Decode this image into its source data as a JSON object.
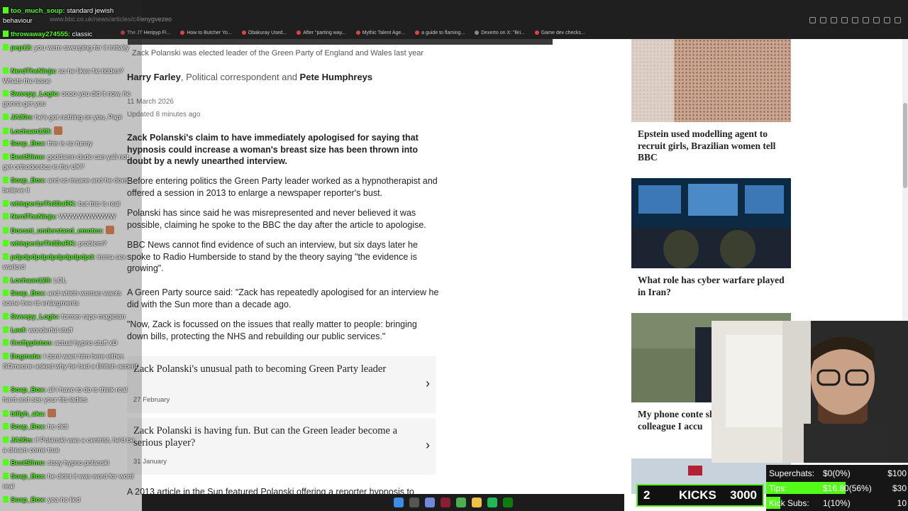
{
  "browser": {
    "url": "www.bbc.co.uk/news/articles/c4lenygvezeo",
    "bookmarks": [
      "The JT Heripyp Fi...",
      "How to Butcher Yo...",
      "Obakuray Used...",
      "After \"parting way...",
      "Mythic Talent Age...",
      "a guide to flaming...",
      "Dexerto on X: \"Bri...",
      "Game dev checks..."
    ]
  },
  "article": {
    "caption": "Zack Polanski was elected leader of the Green Party of England and Wales last year",
    "byline": {
      "author1": "Harry Farley",
      "role": ", Political correspondent and ",
      "author2": "Pete Humphreys"
    },
    "date": "11 March 2026",
    "updated": "Updated 8 minutes ago",
    "paragraphs": [
      "Zack Polanski's claim to have immediately apologised for saying that hypnosis could increase a woman's breast size has been thrown into doubt by a newly unearthed interview.",
      "Before entering politics the Green Party leader worked as a hypnotherapist and offered a session in 2013 to enlarge a newspaper reporter's bust.",
      "Polanski has since said he was misrepresented and never believed it was possible, claiming he spoke to the BBC the day after the article to apologise.",
      "BBC News cannot find evidence of such an interview, but six days later he spoke to Radio Humberside to stand by the theory saying \"the evidence is growing\".",
      "A Green Party source said: \"Zack has repeatedly apologised for an interview he did with the Sun more than a decade ago.",
      "\"Now, Zack is focussed on the issues that really matter to people: bringing down bills, protecting the NHS and rebuilding our public services.\""
    ],
    "related": [
      {
        "title": "Zack Polanski's unusual path to becoming Green Party leader",
        "date": "27 February"
      },
      {
        "title": "Zack Polanski is having fun. But can the Green leader become a serious player?",
        "date": "31 January"
      }
    ],
    "cutoff": "A 2013 article in the Sun featured Polanski offering a reporter hypnosis to"
  },
  "sidebar": [
    {
      "title": "Epstein used modelling agent to recruit girls, Brazilian women tell BBC"
    },
    {
      "title": "What role has cyber warfare played in Iran?"
    },
    {
      "title": "My phone conte shared with the colleague I accu"
    }
  ],
  "chat": [
    {
      "user": "too_much_soup:",
      "text": " standard jewish behaviour"
    },
    {
      "user": "throwaway274555:",
      "text": " classic"
    },
    {
      "user": "pep12:",
      "text": " you were sweeping for it initially"
    },
    {
      "user": "NerdTheNinja:",
      "text": " so he likes fat tiddes? Whats the issue"
    },
    {
      "user": "Sweepy_Logic:",
      "text": " oooo you did it now, he gonna get you"
    },
    {
      "user": "JA30n:",
      "text": " he's got nothing on you, Papi"
    },
    {
      "user": "Lochaan128:",
      "text": "",
      "emote": true
    },
    {
      "user": "Soap_Box:",
      "text": " this is so funny"
    },
    {
      "user": "BestSlime:",
      "text": " goddamn dude can yall not get orthodontics in the UK?"
    },
    {
      "user": "Soap_Box:",
      "text": " and so insane and he does believe it"
    },
    {
      "user": "whisper1nTh3DaRK:",
      "text": " but this is real"
    },
    {
      "user": "NerdTheNinja:",
      "text": " WWWWWWWWW"
    },
    {
      "user": "Doesnt_understand_emotes:",
      "text": "",
      "emote": true
    },
    {
      "user": "whisper1nTh3DaRK:",
      "text": " problem?"
    },
    {
      "user": "pdpdpdpdpdpdpdpdpdpd:",
      "text": " imma sex warlord"
    },
    {
      "user": "Lochaan128:",
      "text": " LOL"
    },
    {
      "user": "Soap_Box:",
      "text": " and which woman wants some free tit enlargments"
    },
    {
      "user": "Sweepy_Logic:",
      "text": " former rape magician"
    },
    {
      "user": "Leef:",
      "text": " wonderful stuff"
    },
    {
      "user": "Craftypiston:",
      "text": " actual hypno stuff xD"
    },
    {
      "user": "Dogmata:",
      "text": " I dont want him here either. SOmeone asked why he had a British accent"
    },
    {
      "user": "Soap_Box:",
      "text": " all i have to do is think real hard and see your tits ladies"
    },
    {
      "user": "billyh_aka:",
      "text": "",
      "emote": true
    },
    {
      "user": "Soap_Box:",
      "text": " he didt"
    },
    {
      "user": "JA30n:",
      "text": " if Polanski was a centrist, he'd be a dream come true"
    },
    {
      "user": "BestSlime:",
      "text": " sissy hypno polanski"
    },
    {
      "user": "Soap_Box:",
      "text": " he didnt it was word for word real"
    },
    {
      "user": "Soap_Box:",
      "text": " yea he lied"
    }
  ],
  "kicks": {
    "count": "2",
    "label": "KICKS",
    "goal": "3000"
  },
  "stats": [
    {
      "label": "Superchats:",
      "value": "$0(0%)",
      "goal": "$100",
      "fill": 0
    },
    {
      "label": "Tips:",
      "value": "$16.80(56%)",
      "goal": "$30",
      "fill": 0.56
    },
    {
      "label": "Kick Subs:",
      "value": "1(10%)",
      "goal": "10",
      "fill": 0.1
    }
  ],
  "colors": {
    "kick_green": "#53fc18",
    "bbc_text": "#202224"
  }
}
